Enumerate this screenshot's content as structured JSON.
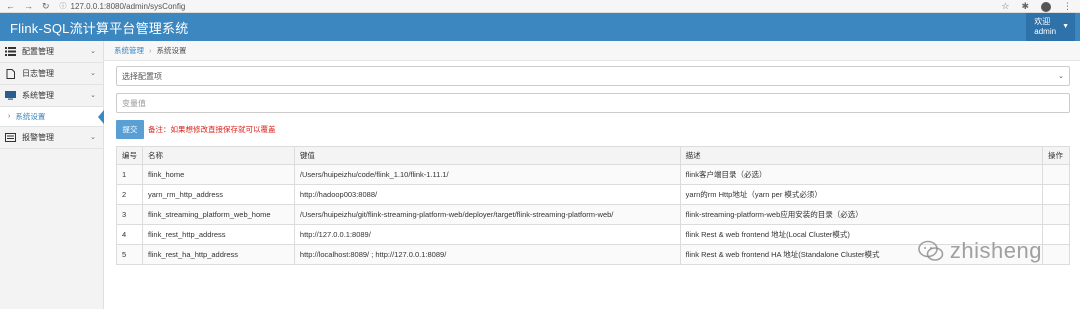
{
  "browser": {
    "url": "127.0.0.1:8080/admin/sysConfig"
  },
  "header": {
    "title": "Flink-SQL流计算平台管理系统",
    "welcome": "欢迎",
    "username": "admin"
  },
  "sidebar": {
    "items": [
      {
        "label": "配置管理",
        "icon": "list-icon"
      },
      {
        "label": "日志管理",
        "icon": "document-icon"
      },
      {
        "label": "系统管理",
        "icon": "monitor-icon"
      },
      {
        "label": "报警管理",
        "icon": "alarm-icon"
      }
    ],
    "active_sub": "系统设置"
  },
  "breadcrumb": {
    "parent": "系统管理",
    "current": "系统设置"
  },
  "form": {
    "select_placeholder": "选择配置项",
    "value_placeholder": "变量值",
    "submit_label": "提交",
    "note": "备注：如果想修改直接保存就可以覆盖"
  },
  "table": {
    "headers": [
      "编号",
      "名称",
      "键值",
      "描述",
      "操作"
    ],
    "rows": [
      [
        "1",
        "flink_home",
        "/Users/huipeizhu/code/flink_1.10/flink-1.11.1/",
        "flink客户端目录（必选）",
        ""
      ],
      [
        "2",
        "yarn_rm_http_address",
        "http://hadoop003:8088/",
        "yarn的rm Http地址（yarn per 模式必须）",
        ""
      ],
      [
        "3",
        "flink_streaming_platform_web_home",
        "/Users/huipeizhu/git/flink-streaming-platform-web/deployer/target/flink-streaming-platform-web/",
        "flink-streaming-platform-web应用安装的目录（必选）",
        ""
      ],
      [
        "4",
        "flink_rest_http_address",
        "http://127.0.0.1:8089/",
        "flink Rest & web frontend 地址(Local Cluster模式)",
        ""
      ],
      [
        "5",
        "flink_rest_ha_http_address",
        "http://localhost:8089/ ; http://127.0.0.1:8089/",
        "flink Rest & web frontend HA 地址(Standalone Cluster模式",
        ""
      ]
    ]
  },
  "watermark": {
    "text": "zhisheng"
  }
}
